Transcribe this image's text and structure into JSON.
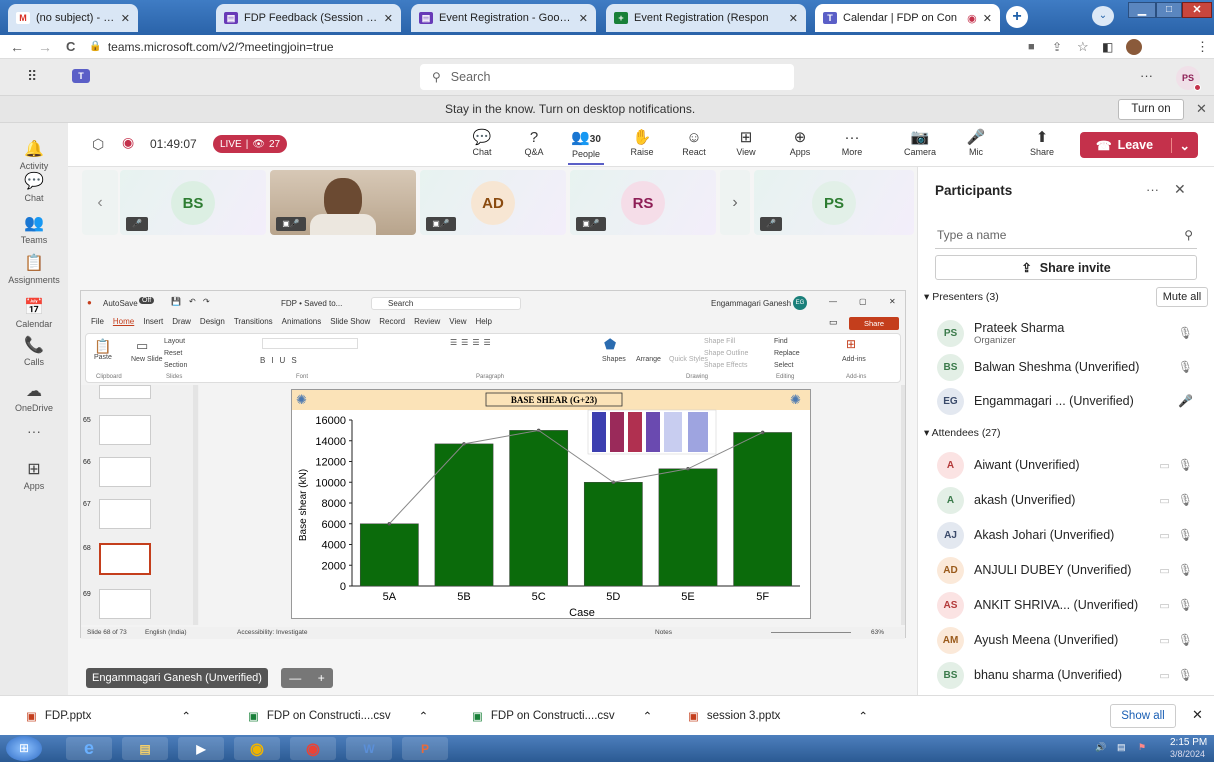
{
  "browser": {
    "tabs": [
      {
        "label": "(no subject) - prateek.sharr",
        "icon": "gmail-icon",
        "color": "#ffffff",
        "glyph": "M"
      },
      {
        "label": "FDP Feedback (Session 2) -",
        "icon": "forms-icon",
        "color": "#673ab7",
        "glyph": "▤"
      },
      {
        "label": "Event Registration - Google",
        "icon": "forms-icon",
        "color": "#673ab7",
        "glyph": "▤"
      },
      {
        "label": "Event Registration (Respon",
        "icon": "sheets-icon",
        "color": "#188038",
        "glyph": "+"
      },
      {
        "label": "Calendar | FDP on Con",
        "icon": "teams-icon",
        "color": "#5b5fc7",
        "glyph": "T"
      }
    ],
    "url": "teams.microsoft.com/v2/?meetingjoin=true"
  },
  "teams": {
    "search_placeholder": "Search",
    "more": "···",
    "user_initials": "PS",
    "notification": "Stay in the know. Turn on desktop notifications.",
    "turn_on": "Turn on",
    "rail": [
      {
        "label": "Activity",
        "glyph": "🔔"
      },
      {
        "label": "Chat",
        "glyph": "💬"
      },
      {
        "label": "Teams",
        "glyph": "👥"
      },
      {
        "label": "Assignments",
        "glyph": "📋"
      },
      {
        "label": "Calendar",
        "glyph": "📅"
      },
      {
        "label": "Calls",
        "glyph": "📞"
      },
      {
        "label": "OneDrive",
        "glyph": "☁"
      },
      {
        "label": "",
        "glyph": "···"
      },
      {
        "label": "Apps",
        "glyph": "⊞"
      }
    ]
  },
  "meeting": {
    "timer": "01:49:07",
    "live": "LIVE",
    "viewers": "27",
    "controls": [
      {
        "label": "Chat",
        "glyph": "💬"
      },
      {
        "label": "Q&A",
        "glyph": "?"
      },
      {
        "label": "People",
        "glyph": "👥",
        "count": "30"
      },
      {
        "label": "Raise",
        "glyph": "✋"
      },
      {
        "label": "React",
        "glyph": "☺"
      },
      {
        "label": "View",
        "glyph": "⊞"
      },
      {
        "label": "Apps",
        "glyph": "⊕"
      },
      {
        "label": "More",
        "glyph": "···"
      }
    ],
    "devices": [
      {
        "label": "Camera",
        "glyph": "📷"
      },
      {
        "label": "Mic",
        "glyph": "🎤"
      },
      {
        "label": "Share",
        "glyph": "⬆"
      }
    ],
    "leave": "Leave",
    "tiles": [
      {
        "initials": "BS",
        "color": "#e2f0e8",
        "text": "#2e7d32"
      },
      {
        "initials": "",
        "color": "#c9b8a5",
        "text": "#000"
      },
      {
        "initials": "AD",
        "color": "#f7e6d3",
        "text": "#8a4b10"
      },
      {
        "initials": "RS",
        "color": "#f5dde8",
        "text": "#8e1f56"
      },
      {
        "initials": "PS",
        "color": "#e2f0e8",
        "text": "#2e7d32"
      }
    ],
    "presenter_label": "Engammagari Ganesh (Unverified)"
  },
  "participants": {
    "title": "Participants",
    "search_placeholder": "Type a name",
    "share_invite": "Share invite",
    "presenters_header": "Presenters (3)",
    "mute_all": "Mute all",
    "presenters": [
      {
        "initials": "PS",
        "name": "Prateek Sharma",
        "role": "Organizer",
        "bg": "#e3efe6",
        "fg": "#3a7a4a"
      },
      {
        "initials": "BS",
        "name": "Balwan Sheshma (Unverified)",
        "bg": "#e3efe6",
        "fg": "#3a7a4a"
      },
      {
        "initials": "EG",
        "name": "Engammagari ... (Unverified)",
        "bg": "#e3e8f0",
        "fg": "#3a4a6a"
      }
    ],
    "attendees_header": "Attendees (27)",
    "attendees": [
      {
        "initials": "A",
        "name": "Aiwant (Unverified)",
        "bg": "#fbe3e3",
        "fg": "#b33a3a"
      },
      {
        "initials": "A",
        "name": "akash (Unverified)",
        "bg": "#e3efe6",
        "fg": "#3a7a4a"
      },
      {
        "initials": "AJ",
        "name": "Akash Johari (Unverified)",
        "bg": "#e3e8f0",
        "fg": "#3a4a6a"
      },
      {
        "initials": "AD",
        "name": "ANJULI DUBEY (Unverified)",
        "bg": "#fbe9d9",
        "fg": "#9a5a1a"
      },
      {
        "initials": "AS",
        "name": "ANKIT SHRIVA... (Unverified)",
        "bg": "#fbe3e3",
        "fg": "#b33a3a"
      },
      {
        "initials": "AM",
        "name": "Ayush Meena (Unverified)",
        "bg": "#fbe9d9",
        "fg": "#9a5a1a"
      },
      {
        "initials": "BS",
        "name": "bhanu sharma (Unverified)",
        "bg": "#e3efe6",
        "fg": "#3a7a4a"
      }
    ]
  },
  "ppt": {
    "autosave": "AutoSave",
    "autosave_state": "Off",
    "doc": "FDP • Saved to...",
    "search": "Search",
    "user": "Engammagari Ganesh",
    "user_initials": "EG",
    "menu": [
      "File",
      "Home",
      "Insert",
      "Draw",
      "Design",
      "Transitions",
      "Animations",
      "Slide Show",
      "Record",
      "Review",
      "View",
      "Help"
    ],
    "share": "Share",
    "groups": [
      "Clipboard",
      "Slides",
      "Font",
      "Paragraph",
      "Drawing",
      "Editing",
      "Add-ins"
    ],
    "ribbon": {
      "paste": "Paste",
      "new_slide": "New Slide",
      "layout": "Layout",
      "reset": "Reset",
      "section": "Section",
      "shapes": "Shapes",
      "arrange": "Arrange",
      "quick_styles": "Quick Styles",
      "shape_fill": "Shape Fill",
      "shape_outline": "Shape Outline",
      "shape_effects": "Shape Effects",
      "find": "Find",
      "replace": "Replace",
      "select": "Select",
      "addins": "Add-ins"
    },
    "thumbs": [
      "65",
      "66",
      "67",
      "68",
      "69"
    ],
    "status_slide": "Slide 68 of 73",
    "status_lang": "English (India)",
    "status_access": "Accessibility: Investigate",
    "notes": "Notes",
    "zoom": "63%"
  },
  "chart_data": {
    "type": "bar",
    "title": "BASE SHEAR (G+23)",
    "categories": [
      "5A",
      "5B",
      "5C",
      "5D",
      "5E",
      "5F"
    ],
    "values": [
      6000,
      13700,
      15000,
      10000,
      11300,
      14800
    ],
    "xlabel": "Case",
    "ylabel": "Base shear (kN)",
    "ylim": [
      0,
      16000
    ],
    "yticks": [
      "0",
      "2000",
      "4000",
      "6000",
      "8000",
      "10000",
      "12000",
      "14000",
      "16000"
    ],
    "bar_color": "#0b6b0b"
  },
  "downloads": {
    "items": [
      "FDP.pptx",
      "FDP on Constructi....csv",
      "FDP on Constructi....csv",
      "session 3.pptx"
    ],
    "show_all": "Show all"
  },
  "taskbar": {
    "time": "2:15 PM",
    "date": "3/8/2024"
  }
}
